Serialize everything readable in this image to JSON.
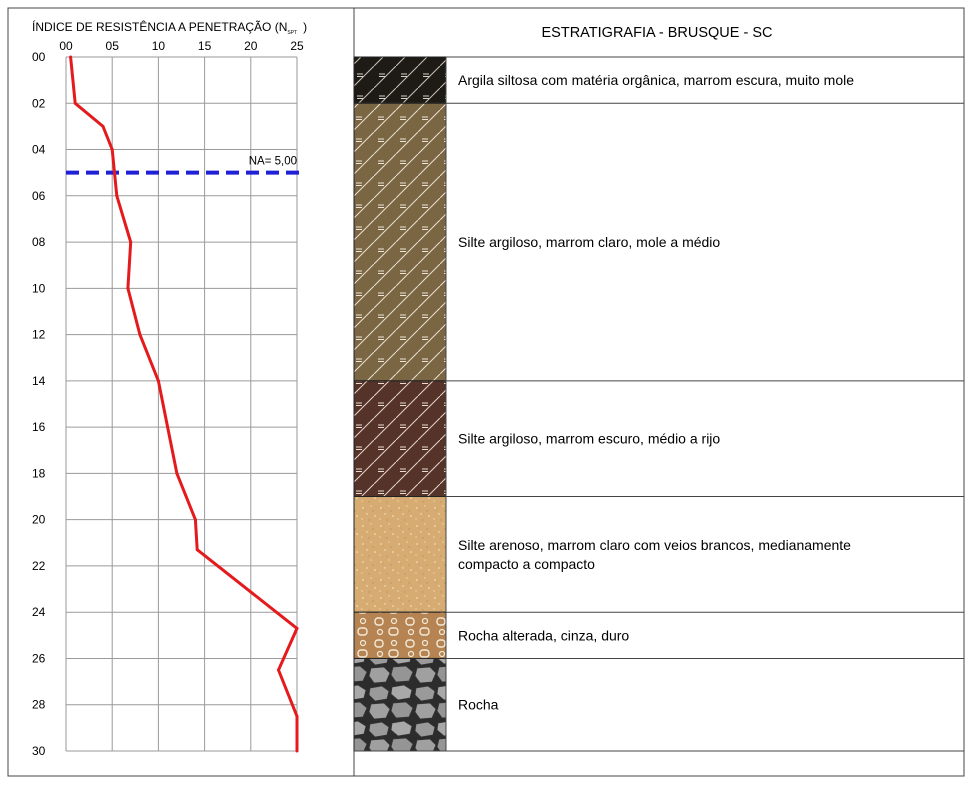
{
  "chart_data": {
    "type": "line",
    "title_main": "ÍNDICE DE RESISTÊNCIA A PENETRAÇÃO (N",
    "title_sub": "SPT",
    "title_close": ")",
    "x_tick_labels": [
      "00",
      "05",
      "10",
      "15",
      "20",
      "25"
    ],
    "x_ticks": [
      0,
      5,
      10,
      15,
      20,
      25
    ],
    "xlim": [
      0,
      25
    ],
    "y_tick_labels": [
      "00",
      "02",
      "04",
      "06",
      "08",
      "10",
      "12",
      "14",
      "16",
      "18",
      "20",
      "22",
      "24",
      "26",
      "28",
      "30"
    ],
    "y_ticks": [
      0,
      2,
      4,
      6,
      8,
      10,
      12,
      14,
      16,
      18,
      20,
      22,
      24,
      26,
      28,
      30
    ],
    "ylim": [
      0,
      30
    ],
    "grid": true,
    "series": [
      {
        "color": "#e41a1c",
        "points": [
          [
            0.5,
            0
          ],
          [
            1,
            2
          ],
          [
            4,
            3
          ],
          [
            5,
            4
          ],
          [
            5.5,
            6
          ],
          [
            7,
            8
          ],
          [
            6.7,
            10
          ],
          [
            8,
            12
          ],
          [
            10,
            14
          ],
          [
            11,
            16
          ],
          [
            12,
            18
          ],
          [
            14,
            20
          ],
          [
            14.2,
            21.3
          ],
          [
            25,
            24.7
          ],
          [
            23,
            26.5
          ],
          [
            25,
            28.5
          ],
          [
            25,
            30
          ]
        ]
      }
    ],
    "water_table": {
      "label": "NA= 5,00",
      "depth": 5,
      "color": "#1f1fd6"
    }
  },
  "stratigraphy": {
    "title": "ESTRATIGRAFIA - BRUSQUE - SC",
    "layers": [
      {
        "top": 0,
        "bottom": 2,
        "pattern": "dark-clay",
        "lines": [
          "Argila siltosa com matéria orgânica, marrom escura, muito mole"
        ]
      },
      {
        "top": 2,
        "bottom": 14,
        "pattern": "light-silt",
        "lines": [
          "Silte argiloso, marrom claro, mole a médio"
        ]
      },
      {
        "top": 14,
        "bottom": 19,
        "pattern": "dark-silt",
        "lines": [
          "Silte argiloso, marrom escuro, médio a rijo"
        ]
      },
      {
        "top": 19,
        "bottom": 24,
        "pattern": "sandy-silt",
        "lines": [
          "Silte arenoso, marrom claro com veios brancos, medianamente",
          "compacto a compacto"
        ]
      },
      {
        "top": 24,
        "bottom": 26,
        "pattern": "weathered-rock",
        "lines": [
          "Rocha alterada, cinza, duro"
        ]
      },
      {
        "top": 26,
        "bottom": 30,
        "pattern": "rock",
        "lines": [
          "Rocha"
        ]
      }
    ]
  }
}
